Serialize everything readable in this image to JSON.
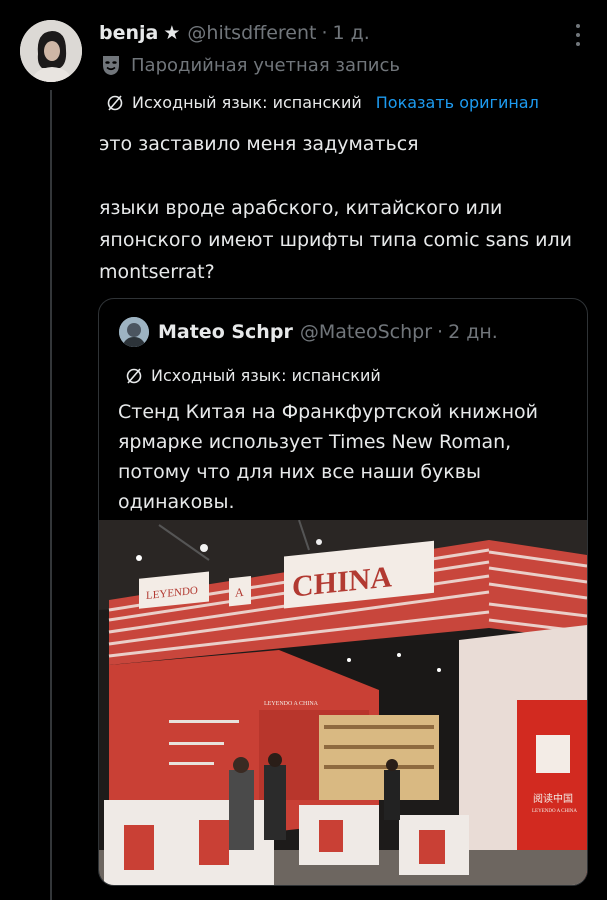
{
  "tweet": {
    "author_name": "benja",
    "author_handle": "@hitsdfferent",
    "time": "1 д.",
    "parody_label": "Пародийная учетная запись",
    "source_language": "Исходный язык: испанский",
    "show_original": "Показать оригинал",
    "paragraphs": [
      "это заставило меня задуматься",
      "языки вроде арабского, китайского или японского имеют шрифты типа comic sans или montserrat?"
    ]
  },
  "quote": {
    "author_name": "Mateo Schpr",
    "author_handle": "@MateoSchpr",
    "time": "2 дн.",
    "source_language": "Исходный язык: испанский",
    "text": "Стенд Китая на Франкфуртской книжной ярмарке использует Times New Roman, потому что для них все наши буквы одинаковы.",
    "photo": {
      "sign_left": "LEYENDO",
      "sign_mid": "A",
      "sign_main": "CHINA",
      "panel_chinese": "阅读中国",
      "panel_sub": "LEYENDO A CHINA",
      "inner_sign": "LEYENDO A CHINA"
    }
  },
  "icons": {
    "more": "more-icon",
    "parody": "parody-mask-icon",
    "translate": "translate-icon",
    "star": "star-icon"
  },
  "colors": {
    "link": "#1d9bf0",
    "secondary": "#71767b",
    "background": "#000000"
  }
}
